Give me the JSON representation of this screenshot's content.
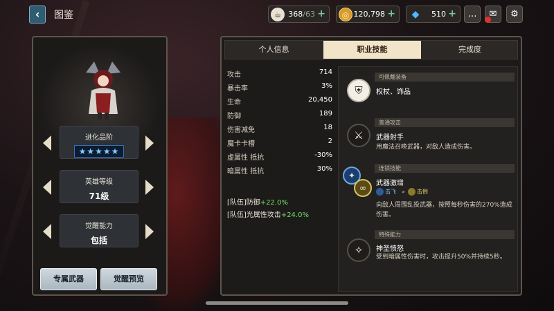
{
  "header": {
    "back_icon": "back-chevron-icon",
    "title": "图鉴",
    "currencies": [
      {
        "name": "stamina",
        "icon": "coffee-cup-icon",
        "value": "368",
        "max": "/63"
      },
      {
        "name": "gold",
        "icon": "gold-coin-icon",
        "value": "120,798"
      },
      {
        "name": "gems",
        "icon": "blue-gem-icon",
        "value": "510"
      }
    ],
    "plus_symbol": "+",
    "buttons": [
      "chat-icon",
      "mail-icon",
      "settings-gear-icon"
    ]
  },
  "left_panel": {
    "evolution": {
      "label": "进化品阶",
      "stars": "★★★★★"
    },
    "level": {
      "label": "英雄等级",
      "value": "71级"
    },
    "awakening": {
      "label": "觉醒能力",
      "value": "包括"
    },
    "buttons": {
      "exclusive_weapon": "专属武器",
      "awaken_preview": "觉醒预览"
    }
  },
  "tabs": [
    "个人信息",
    "职业技能",
    "完成度"
  ],
  "active_tab": 1,
  "stats": [
    {
      "label": "攻击",
      "value": "714"
    },
    {
      "label": "暴击率",
      "value": "3%"
    },
    {
      "label": "生命",
      "value": "20,450"
    },
    {
      "label": "防御",
      "value": "189"
    },
    {
      "label": "伤害减免",
      "value": "18"
    },
    {
      "label": "魔卡卡槽",
      "value": "2"
    },
    {
      "label": "虚属性 抵抗",
      "value": "-30%"
    },
    {
      "label": "暗属性 抵抗",
      "value": "30%"
    }
  ],
  "team_bonuses": [
    {
      "label": "[队伍]防御",
      "value": "+22.0%"
    },
    {
      "label": "[队伍]光属性攻击",
      "value": "+24.0%"
    }
  ],
  "skills": {
    "equip": {
      "tag": "可佩戴装备",
      "name": "权杖、饰品",
      "icon": "equipment-shield-icon"
    },
    "normal": {
      "tag": "普通攻击",
      "name": "武器射手",
      "desc": "用魔法召唤武器，对敌人造成伤害。",
      "icon": "sword-icon"
    },
    "chain": {
      "tag": "连锁技能",
      "name": "武器激增",
      "from": "击飞",
      "to": "击倒",
      "desc": "向敌人周围乱投武器，按照每秒伤害的270%造成伤害。",
      "icon": "weapon-surge-icon"
    },
    "special": {
      "tag": "特殊能力",
      "name": "神圣愤怒",
      "desc": "受到暗属性伤害时，攻击提升50%并持续5秒。",
      "icon": "sparkle-icon"
    }
  },
  "colors": {
    "accent_tab": "#f2e4c8",
    "bonus_green": "#6fe06a",
    "notification_red": "#e0312c"
  }
}
